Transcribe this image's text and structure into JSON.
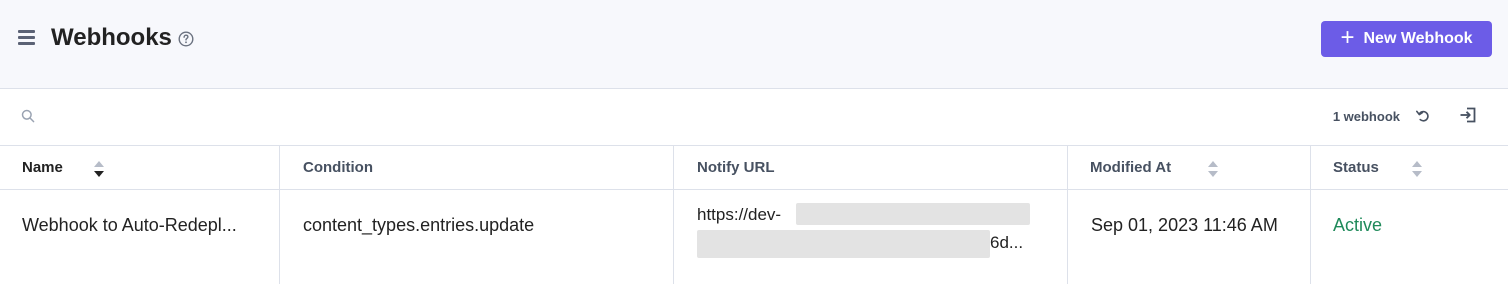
{
  "header": {
    "title": "Webhooks",
    "new_button_label": "New Webhook",
    "new_button_icon": "plus-icon",
    "accent_color": "#6c5ce7"
  },
  "toolbar": {
    "count_label": "1 webhook"
  },
  "table": {
    "columns": [
      "Name",
      "Condition",
      "Notify URL",
      "Modified At",
      "Status"
    ],
    "rows": [
      {
        "name": "Webhook to Auto-Redepl...",
        "condition": "content_types.entries.update",
        "notify_url_start": "https://dev-",
        "notify_url_end": "6d...",
        "modified_at": "Sep 01, 2023 11:46 AM",
        "status": "Active",
        "status_color": "#1f8a5a"
      }
    ]
  }
}
